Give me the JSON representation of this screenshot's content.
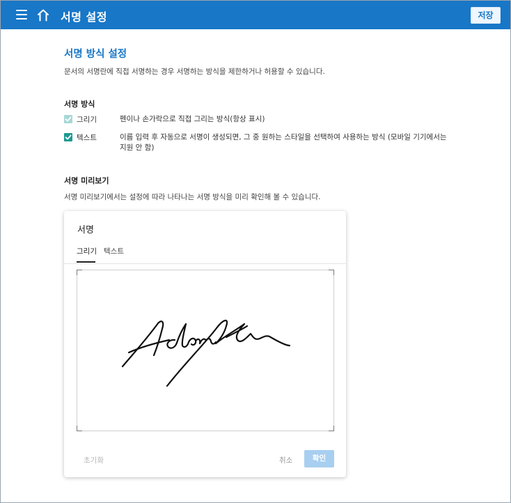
{
  "header": {
    "title": "서명 설정",
    "save_label": "저장",
    "color": "#1877c7"
  },
  "section": {
    "title": "서명 방식 설정",
    "description": "문서의 서명란에 직접 서명하는 경우 서명하는 방식을 제한하거나 허용할 수 있습니다."
  },
  "methods": {
    "heading": "서명 방식",
    "options": [
      {
        "label": "그리기",
        "description": "펜이나 손가락으로 직접 그리는 방식(항상 표시)",
        "checked": true,
        "disabled": true
      },
      {
        "label": "텍스트",
        "description": "이름 입력 후 자동으로 서명이 생성되면, 그 중 원하는 스타일을 선택하여 사용하는 방식 (모바일 기기에서는 지원 안 함)",
        "checked": true,
        "disabled": false
      }
    ]
  },
  "preview": {
    "heading": "서명 미리보기",
    "description": "서명 미리보기에서는 설정에 따라 나타나는 서명 방식을 미리 확인해 볼 수 있습니다."
  },
  "dialog": {
    "title": "서명",
    "tabs": [
      {
        "label": "그리기",
        "active": true
      },
      {
        "label": "텍스트",
        "active": false
      }
    ],
    "reset_label": "초기화",
    "cancel_label": "취소",
    "confirm_label": "확인"
  }
}
